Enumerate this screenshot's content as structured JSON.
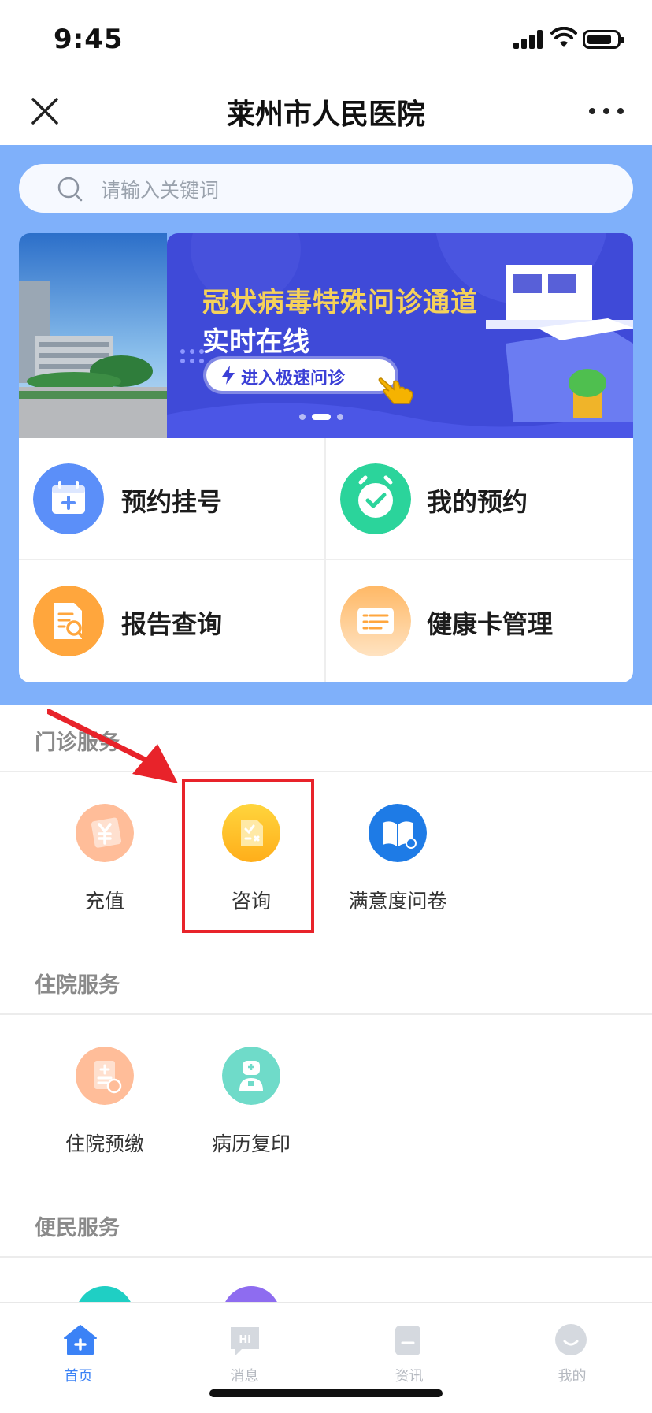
{
  "status_bar": {
    "time": "9:45"
  },
  "nav": {
    "title": "莱州市人民医院"
  },
  "search": {
    "placeholder": "请输入关键词"
  },
  "banner": {
    "line1": "冠状病毒特殊问诊通道",
    "line2": "实时在线",
    "button_label": "进入极速问诊",
    "slides": 3,
    "active_slide": 2
  },
  "quick_actions": [
    {
      "label": "预约挂号",
      "icon": "calendar-plus-icon",
      "color": "#5b8ff9"
    },
    {
      "label": "我的预约",
      "icon": "alarm-check-icon",
      "color": "#2bd49b"
    },
    {
      "label": "报告查询",
      "icon": "report-search-icon",
      "color": "#ffa63d"
    },
    {
      "label": "健康卡管理",
      "icon": "health-card-icon",
      "color": "#ffc27a"
    }
  ],
  "sections": {
    "outpatient": {
      "title": "门诊服务",
      "items": [
        {
          "label": "充值",
          "icon": "yuan-card-icon",
          "color": "#ffbd99"
        },
        {
          "label": "咨询",
          "icon": "consult-document-icon",
          "color": "#ffc53d"
        },
        {
          "label": "满意度问卷",
          "icon": "book-questionnaire-icon",
          "color": "#1e7be6"
        }
      ]
    },
    "inpatient": {
      "title": "住院服务",
      "items": [
        {
          "label": "住院预缴",
          "icon": "prepay-document-icon",
          "color": "#ffbd99"
        },
        {
          "label": "病历复印",
          "icon": "medical-record-icon",
          "color": "#6fdbc9"
        }
      ]
    },
    "convenience": {
      "title": "便民服务"
    }
  },
  "tabbar": [
    {
      "label": "首页",
      "icon": "home-icon",
      "active": true
    },
    {
      "label": "消息",
      "icon": "message-icon",
      "active": false
    },
    {
      "label": "资讯",
      "icon": "news-icon",
      "active": false
    },
    {
      "label": "我的",
      "icon": "profile-icon",
      "active": false
    }
  ],
  "colors": {
    "hero_bg": "#7fb0fa",
    "tab_active": "#3b82f6",
    "tab_inactive": "#b5b9c0",
    "highlight": "#e8232a"
  }
}
